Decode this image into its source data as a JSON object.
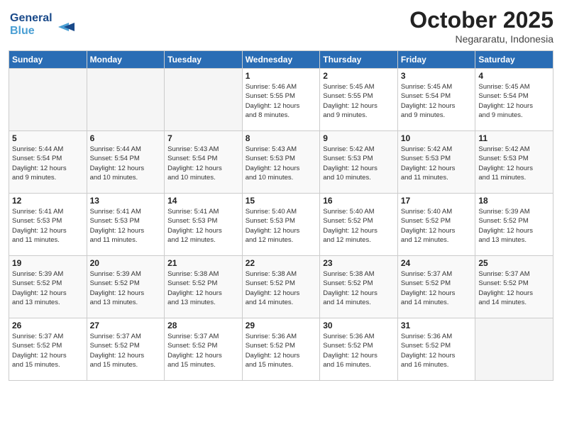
{
  "header": {
    "logo_line1": "General",
    "logo_line2": "Blue",
    "month_year": "October 2025",
    "location": "Negararatu, Indonesia"
  },
  "weekdays": [
    "Sunday",
    "Monday",
    "Tuesday",
    "Wednesday",
    "Thursday",
    "Friday",
    "Saturday"
  ],
  "weeks": [
    [
      {
        "day": "",
        "info": ""
      },
      {
        "day": "",
        "info": ""
      },
      {
        "day": "",
        "info": ""
      },
      {
        "day": "1",
        "info": "Sunrise: 5:46 AM\nSunset: 5:55 PM\nDaylight: 12 hours\nand 8 minutes."
      },
      {
        "day": "2",
        "info": "Sunrise: 5:45 AM\nSunset: 5:55 PM\nDaylight: 12 hours\nand 9 minutes."
      },
      {
        "day": "3",
        "info": "Sunrise: 5:45 AM\nSunset: 5:54 PM\nDaylight: 12 hours\nand 9 minutes."
      },
      {
        "day": "4",
        "info": "Sunrise: 5:45 AM\nSunset: 5:54 PM\nDaylight: 12 hours\nand 9 minutes."
      }
    ],
    [
      {
        "day": "5",
        "info": "Sunrise: 5:44 AM\nSunset: 5:54 PM\nDaylight: 12 hours\nand 9 minutes."
      },
      {
        "day": "6",
        "info": "Sunrise: 5:44 AM\nSunset: 5:54 PM\nDaylight: 12 hours\nand 10 minutes."
      },
      {
        "day": "7",
        "info": "Sunrise: 5:43 AM\nSunset: 5:54 PM\nDaylight: 12 hours\nand 10 minutes."
      },
      {
        "day": "8",
        "info": "Sunrise: 5:43 AM\nSunset: 5:53 PM\nDaylight: 12 hours\nand 10 minutes."
      },
      {
        "day": "9",
        "info": "Sunrise: 5:42 AM\nSunset: 5:53 PM\nDaylight: 12 hours\nand 10 minutes."
      },
      {
        "day": "10",
        "info": "Sunrise: 5:42 AM\nSunset: 5:53 PM\nDaylight: 12 hours\nand 11 minutes."
      },
      {
        "day": "11",
        "info": "Sunrise: 5:42 AM\nSunset: 5:53 PM\nDaylight: 12 hours\nand 11 minutes."
      }
    ],
    [
      {
        "day": "12",
        "info": "Sunrise: 5:41 AM\nSunset: 5:53 PM\nDaylight: 12 hours\nand 11 minutes."
      },
      {
        "day": "13",
        "info": "Sunrise: 5:41 AM\nSunset: 5:53 PM\nDaylight: 12 hours\nand 11 minutes."
      },
      {
        "day": "14",
        "info": "Sunrise: 5:41 AM\nSunset: 5:53 PM\nDaylight: 12 hours\nand 12 minutes."
      },
      {
        "day": "15",
        "info": "Sunrise: 5:40 AM\nSunset: 5:53 PM\nDaylight: 12 hours\nand 12 minutes."
      },
      {
        "day": "16",
        "info": "Sunrise: 5:40 AM\nSunset: 5:52 PM\nDaylight: 12 hours\nand 12 minutes."
      },
      {
        "day": "17",
        "info": "Sunrise: 5:40 AM\nSunset: 5:52 PM\nDaylight: 12 hours\nand 12 minutes."
      },
      {
        "day": "18",
        "info": "Sunrise: 5:39 AM\nSunset: 5:52 PM\nDaylight: 12 hours\nand 13 minutes."
      }
    ],
    [
      {
        "day": "19",
        "info": "Sunrise: 5:39 AM\nSunset: 5:52 PM\nDaylight: 12 hours\nand 13 minutes."
      },
      {
        "day": "20",
        "info": "Sunrise: 5:39 AM\nSunset: 5:52 PM\nDaylight: 12 hours\nand 13 minutes."
      },
      {
        "day": "21",
        "info": "Sunrise: 5:38 AM\nSunset: 5:52 PM\nDaylight: 12 hours\nand 13 minutes."
      },
      {
        "day": "22",
        "info": "Sunrise: 5:38 AM\nSunset: 5:52 PM\nDaylight: 12 hours\nand 14 minutes."
      },
      {
        "day": "23",
        "info": "Sunrise: 5:38 AM\nSunset: 5:52 PM\nDaylight: 12 hours\nand 14 minutes."
      },
      {
        "day": "24",
        "info": "Sunrise: 5:37 AM\nSunset: 5:52 PM\nDaylight: 12 hours\nand 14 minutes."
      },
      {
        "day": "25",
        "info": "Sunrise: 5:37 AM\nSunset: 5:52 PM\nDaylight: 12 hours\nand 14 minutes."
      }
    ],
    [
      {
        "day": "26",
        "info": "Sunrise: 5:37 AM\nSunset: 5:52 PM\nDaylight: 12 hours\nand 15 minutes."
      },
      {
        "day": "27",
        "info": "Sunrise: 5:37 AM\nSunset: 5:52 PM\nDaylight: 12 hours\nand 15 minutes."
      },
      {
        "day": "28",
        "info": "Sunrise: 5:37 AM\nSunset: 5:52 PM\nDaylight: 12 hours\nand 15 minutes."
      },
      {
        "day": "29",
        "info": "Sunrise: 5:36 AM\nSunset: 5:52 PM\nDaylight: 12 hours\nand 15 minutes."
      },
      {
        "day": "30",
        "info": "Sunrise: 5:36 AM\nSunset: 5:52 PM\nDaylight: 12 hours\nand 16 minutes."
      },
      {
        "day": "31",
        "info": "Sunrise: 5:36 AM\nSunset: 5:52 PM\nDaylight: 12 hours\nand 16 minutes."
      },
      {
        "day": "",
        "info": ""
      }
    ]
  ]
}
